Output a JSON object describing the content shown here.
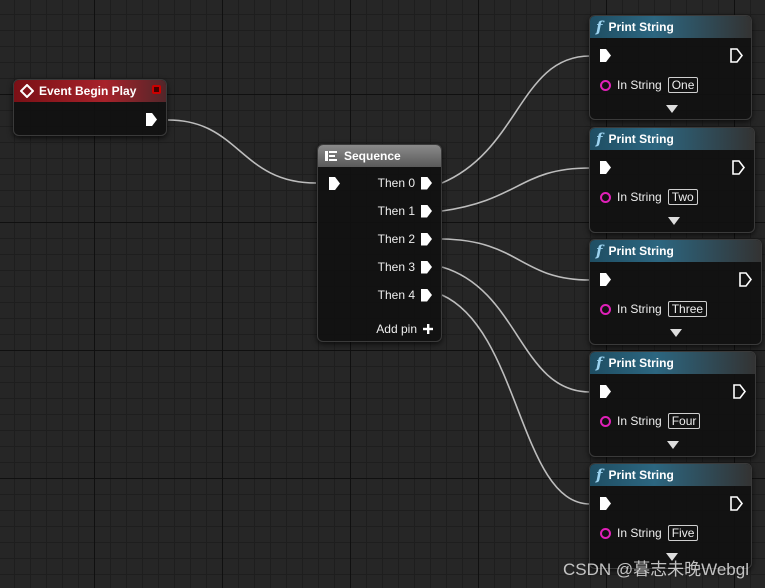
{
  "event_node": {
    "title": "Event Begin Play"
  },
  "sequence_node": {
    "title": "Sequence",
    "outputs": [
      "Then 0",
      "Then 1",
      "Then 2",
      "Then 3",
      "Then 4"
    ],
    "add_pin_label": "Add pin"
  },
  "print_nodes": [
    {
      "title": "Print String",
      "pin_label": "In String",
      "value": "One"
    },
    {
      "title": "Print String",
      "pin_label": "In String",
      "value": "Two"
    },
    {
      "title": "Print String",
      "pin_label": "In String",
      "value": "Three"
    },
    {
      "title": "Print String",
      "pin_label": "In String",
      "value": "Four"
    },
    {
      "title": "Print String",
      "pin_label": "In String",
      "value": "Five"
    }
  ],
  "watermark": "CSDN @暮志未晚Webgl",
  "colors": {
    "event_header": "#a7222a",
    "function_header": "#2c6680",
    "string_pin": "#e020b8",
    "wire": "#bdbdbd"
  },
  "icons": [
    "delegate-pin-icon",
    "exec-pin-icon",
    "function-icon",
    "sequence-icon",
    "add-pin-icon",
    "expand-arrow-icon"
  ]
}
